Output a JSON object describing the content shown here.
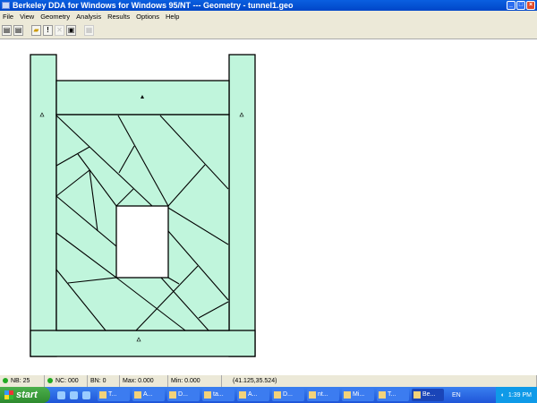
{
  "window": {
    "title": "Berkeley DDA for Windows for Windows 95/NT  ---  Geometry - tunnel1.geo"
  },
  "menu": [
    "File",
    "View",
    "Geometry",
    "Analysis",
    "Results",
    "Options",
    "Help"
  ],
  "toolbar": [
    {
      "icon": "new-file-icon"
    },
    {
      "icon": "new-doc-icon"
    },
    {
      "icon": "open-folder-icon"
    },
    {
      "icon": "exclamation-icon",
      "label": "!"
    },
    {
      "icon": "close-x-icon",
      "label": "✕",
      "disabled": true
    },
    {
      "icon": "copy-icon"
    },
    {
      "icon": "print-icon",
      "disabled": true
    }
  ],
  "status": {
    "nb": "NB: 25",
    "nc": "NC: 000",
    "bn": "BN: 0",
    "max": "Max: 0.000",
    "min": "Min: 0.000",
    "coords": "(41.125,35.524)"
  },
  "taskbar": {
    "start": "start",
    "tasks": [
      "T...",
      "A...",
      "D...",
      "ta...",
      "A...",
      "D...",
      "nt...",
      "Mi...",
      "T...",
      "Be..."
    ],
    "lang": "EN",
    "clock": "1:39 PM"
  },
  "colors": {
    "block_fill": "#c0f5dc",
    "line": "#000000",
    "title_bar": "#0a5fe0",
    "status_ok": "#22aa22"
  }
}
